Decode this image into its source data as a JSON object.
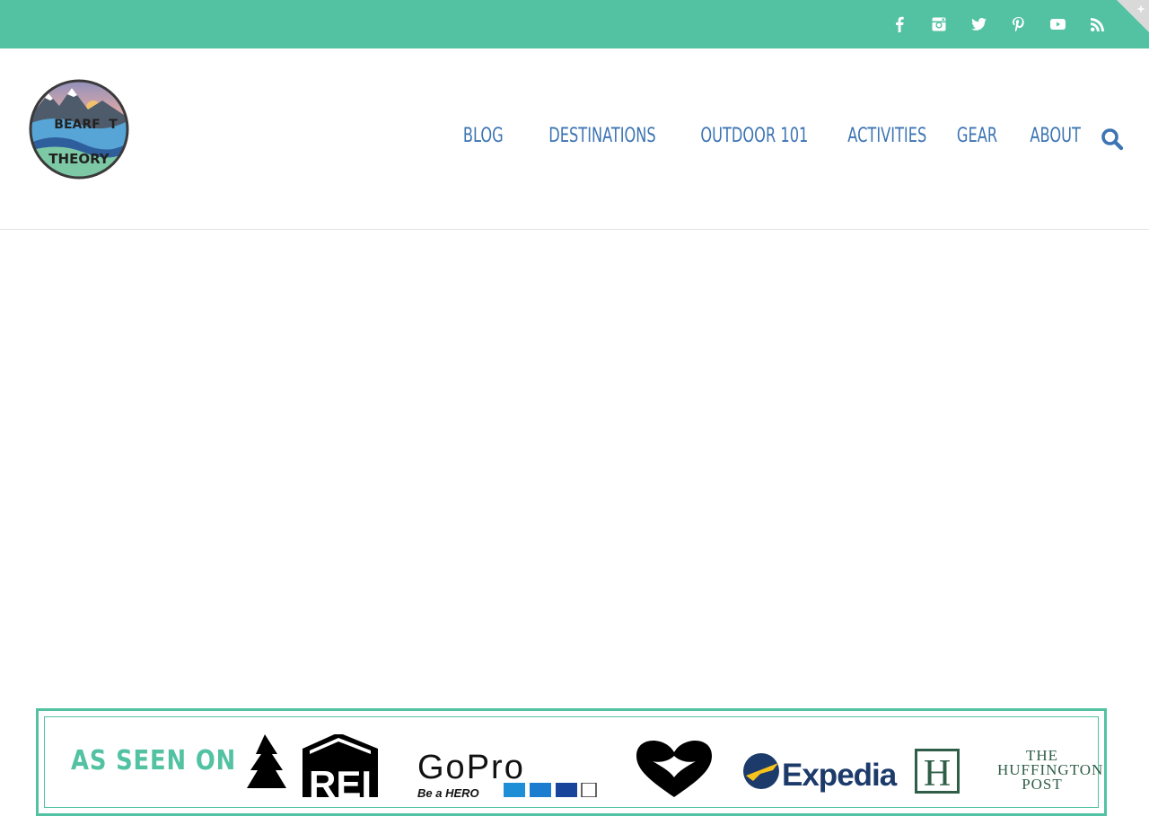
{
  "topbar": {
    "social_icons": [
      "facebook-icon",
      "instagram-icon",
      "twitter-icon",
      "pinterest-icon",
      "youtube-icon",
      "rss-icon"
    ],
    "corner_toggle": "+"
  },
  "logo": {
    "line1": "BEARF",
    "line1_end": "T",
    "line2": "THEORY"
  },
  "nav": {
    "items": [
      "BLOG",
      "DESTINATIONS",
      "OUTDOOR 101",
      "ACTIVITIES",
      "GEAR",
      "ABOUT"
    ]
  },
  "banner": {
    "title": "AS SEEN ON",
    "brands": {
      "rei": "REI",
      "gopro": "GoPro",
      "gopro_sub": "Be a HERO",
      "expedia": "Expedia",
      "huffington": "THE HUFFINGTON POST",
      "huffington_mark": "H"
    }
  },
  "colors": {
    "accent_teal": "#52c2a2",
    "nav_blue": "#3d74b3"
  }
}
